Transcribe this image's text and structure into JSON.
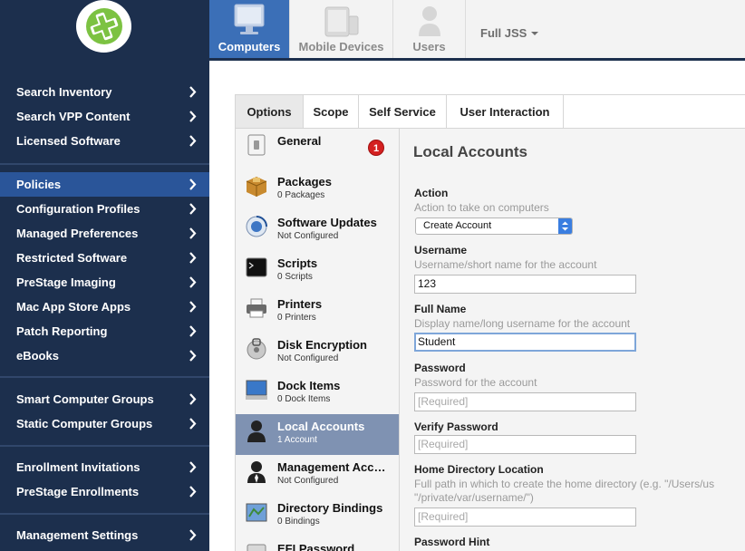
{
  "sidebar": {
    "group1": [
      "Search Inventory",
      "Search VPP Content",
      "Licensed Software"
    ],
    "group2": [
      "Policies",
      "Configuration Profiles",
      "Managed Preferences",
      "Restricted Software",
      "PreStage Imaging",
      "Mac App Store Apps",
      "Patch Reporting",
      "eBooks"
    ],
    "group3": [
      "Smart Computer Groups",
      "Static Computer Groups"
    ],
    "group4": [
      "Enrollment Invitations",
      "PreStage Enrollments"
    ],
    "group5": [
      "Management Settings"
    ],
    "active": "Policies"
  },
  "topnav": {
    "tabs": [
      "Computers",
      "Mobile Devices",
      "Users"
    ],
    "active": "Computers",
    "site": "Full JSS"
  },
  "content_tabs": {
    "tabs": [
      "Options",
      "Scope",
      "Self Service",
      "User Interaction"
    ],
    "active": "Options"
  },
  "payloads": [
    {
      "title": "General",
      "subtitle": "",
      "badge": "1",
      "icon": "general-icon"
    },
    {
      "title": "Packages",
      "subtitle": "0 Packages",
      "icon": "package-icon"
    },
    {
      "title": "Software Updates",
      "subtitle": "Not Configured",
      "icon": "software-update-icon"
    },
    {
      "title": "Scripts",
      "subtitle": "0 Scripts",
      "icon": "terminal-icon"
    },
    {
      "title": "Printers",
      "subtitle": "0 Printers",
      "icon": "printer-icon"
    },
    {
      "title": "Disk Encryption",
      "subtitle": "Not Configured",
      "icon": "disk-encryption-icon"
    },
    {
      "title": "Dock Items",
      "subtitle": "0 Dock Items",
      "icon": "dock-icon"
    },
    {
      "title": "Local Accounts",
      "subtitle": "1 Account",
      "icon": "user-icon"
    },
    {
      "title": "Management Acc…",
      "subtitle": "Not Configured",
      "icon": "management-account-icon"
    },
    {
      "title": "Directory Bindings",
      "subtitle": "0 Bindings",
      "icon": "directory-icon"
    },
    {
      "title": "EFI Password",
      "subtitle": "",
      "icon": "efi-icon"
    }
  ],
  "form": {
    "title": "Local Accounts",
    "action": {
      "label": "Action",
      "desc": "Action to take on computers",
      "value": "Create Account"
    },
    "username": {
      "label": "Username",
      "desc": "Username/short name for the account",
      "value": "123"
    },
    "fullname": {
      "label": "Full Name",
      "desc": "Display name/long username for the account",
      "value": "Student"
    },
    "password": {
      "label": "Password",
      "desc": "Password for the account",
      "placeholder": "[Required]"
    },
    "verify": {
      "label": "Verify Password",
      "placeholder": "[Required]"
    },
    "homedir": {
      "label": "Home Directory Location",
      "desc1": "Full path in which to create the home directory (e.g. \"/Users/us",
      "desc2": "\"/private/var/username/\")",
      "placeholder": "[Required]"
    },
    "hint": {
      "label": "Password Hint"
    }
  },
  "colors": {
    "sidebar_bg": "#1c2f4d",
    "sidebar_active": "#2a5599",
    "tab_active": "#3b6fb7",
    "payload_active": "#7f92b2",
    "logo_green": "#7cc242"
  }
}
